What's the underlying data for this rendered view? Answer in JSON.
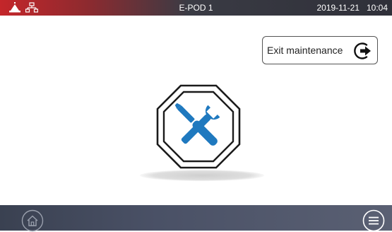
{
  "header": {
    "title": "E-POD 1",
    "date": "2019-11-21",
    "time": "10:04",
    "icons": [
      "alarm-light-icon",
      "network-icon"
    ]
  },
  "main": {
    "exit_button_label": "Exit maintenance",
    "exit_icon": "exit-arrow-icon",
    "status_icon": "maintenance-tools-icon"
  },
  "footer": {
    "home_icon": "home-icon",
    "menu_icon": "menu-icon"
  },
  "colors": {
    "header_red": "#c4262a",
    "header_dark": "#2f3039",
    "tool_blue": "#1f79bf",
    "footer": "#4a5166"
  }
}
